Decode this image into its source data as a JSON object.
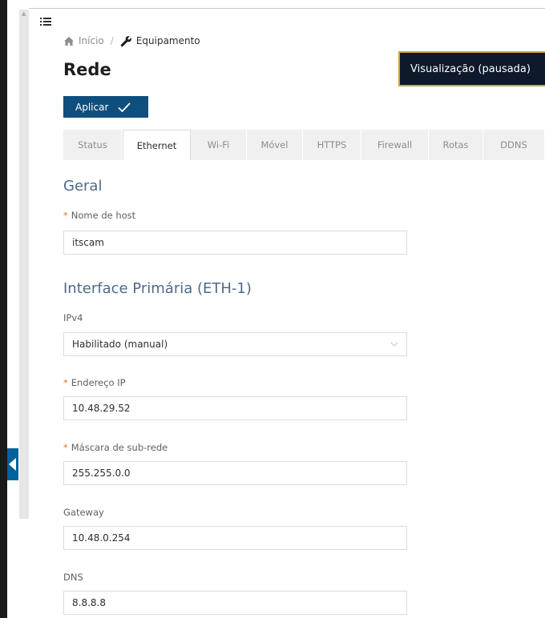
{
  "breadcrumb": {
    "home": "Início",
    "separator": "/",
    "current": "Equipamento"
  },
  "page": {
    "title": "Rede"
  },
  "preview": {
    "label": "Visualização (pausada)"
  },
  "toolbar": {
    "apply_label": "Aplicar"
  },
  "tabs": [
    {
      "label": "Status",
      "active": false
    },
    {
      "label": "Ethernet",
      "active": true
    },
    {
      "label": "Wi-Fi",
      "active": false
    },
    {
      "label": "Móvel",
      "active": false
    },
    {
      "label": "HTTPS",
      "active": false
    },
    {
      "label": "Firewall",
      "active": false
    },
    {
      "label": "Rotas",
      "active": false
    },
    {
      "label": "DDNS",
      "active": false
    }
  ],
  "general": {
    "title": "Geral",
    "hostname": {
      "required_mark": "*",
      "label": "Nome de host",
      "value": "itscam"
    }
  },
  "primary_interface": {
    "title": "Interface Primária (ETH-1)",
    "ipv4": {
      "label": "IPv4",
      "value": "Habilitado (manual)"
    },
    "ip_address": {
      "required_mark": "*",
      "label": "Endereço IP",
      "value": "10.48.29.52"
    },
    "subnet_mask": {
      "required_mark": "*",
      "label": "Máscara de sub-rede",
      "value": "255.255.0.0"
    },
    "gateway": {
      "label": "Gateway",
      "value": "10.48.0.254"
    },
    "dns": {
      "label": "DNS",
      "value": "8.8.8.8"
    }
  },
  "colors": {
    "primary_button": "#0e4f7d",
    "section_title": "#4d6a87",
    "required_mark": "#d9772a",
    "preview_border": "#d6a533",
    "preview_background": "#0e1a2b",
    "collapse_tab": "#00629b"
  },
  "icons": {
    "menu": "menu-list-icon",
    "home": "home-icon",
    "equipment": "wrench-icon",
    "apply": "checkmark-icon",
    "select": "chevron-down-icon",
    "collapse": "chevron-left-icon"
  }
}
